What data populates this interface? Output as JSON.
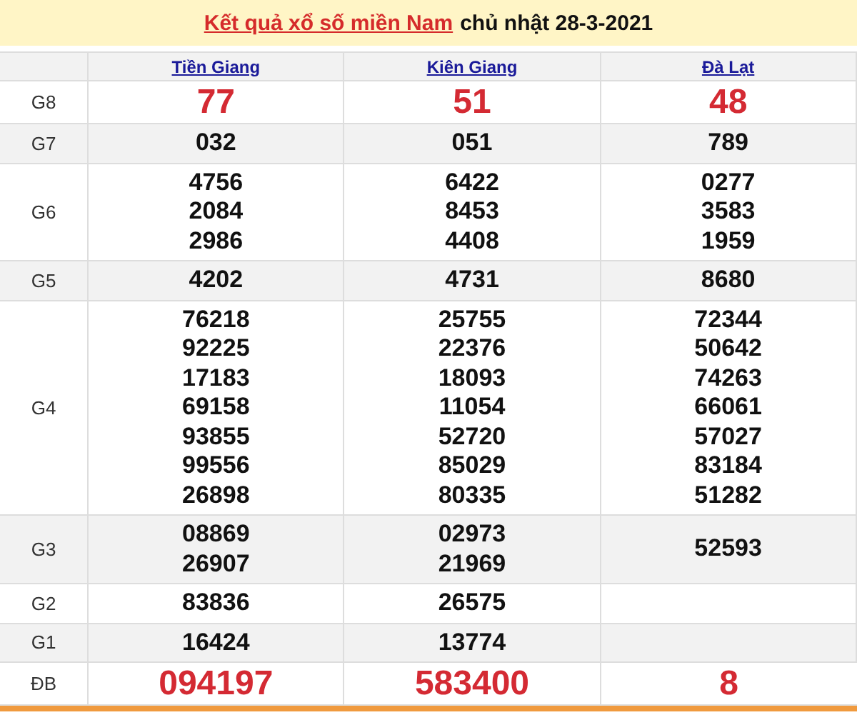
{
  "title": {
    "link": "Kết quả xổ số miền Nam",
    "date": "chủ nhật 28-3-2021"
  },
  "provinces": [
    "Tiền Giang",
    "Kiên Giang",
    "Đà Lạt"
  ],
  "rows": [
    {
      "prize": "G8",
      "kind": "highlight",
      "results": [
        [
          "77"
        ],
        [
          "51"
        ],
        [
          "48"
        ]
      ]
    },
    {
      "prize": "G7",
      "kind": "normal",
      "results": [
        [
          "032"
        ],
        [
          "051"
        ],
        [
          "789"
        ]
      ]
    },
    {
      "prize": "G6",
      "kind": "normal",
      "results": [
        [
          "4756",
          "2084",
          "2986"
        ],
        [
          "6422",
          "8453",
          "4408"
        ],
        [
          "0277",
          "3583",
          "1959"
        ]
      ]
    },
    {
      "prize": "G5",
      "kind": "normal",
      "results": [
        [
          "4202"
        ],
        [
          "4731"
        ],
        [
          "8680"
        ]
      ]
    },
    {
      "prize": "G4",
      "kind": "normal",
      "results": [
        [
          "76218",
          "92225",
          "17183",
          "69158",
          "93855",
          "99556",
          "26898"
        ],
        [
          "25755",
          "22376",
          "18093",
          "11054",
          "52720",
          "85029",
          "80335"
        ],
        [
          "72344",
          "50642",
          "74263",
          "66061",
          "57027",
          "83184",
          "51282"
        ]
      ]
    },
    {
      "prize": "G3",
      "kind": "normal",
      "results": [
        [
          "08869",
          "26907"
        ],
        [
          "02973",
          "21969"
        ],
        [
          "52593"
        ]
      ]
    },
    {
      "prize": "G2",
      "kind": "normal",
      "results": [
        [
          "83836"
        ],
        [
          "26575"
        ]
      ]
    },
    {
      "prize": "G1",
      "kind": "normal",
      "results": [
        [
          "16424"
        ],
        [
          "13774"
        ]
      ]
    },
    {
      "prize": "ĐB",
      "kind": "highlight",
      "results": [
        [
          "094197"
        ],
        [
          "583400"
        ],
        [
          "8"
        ]
      ]
    }
  ]
}
